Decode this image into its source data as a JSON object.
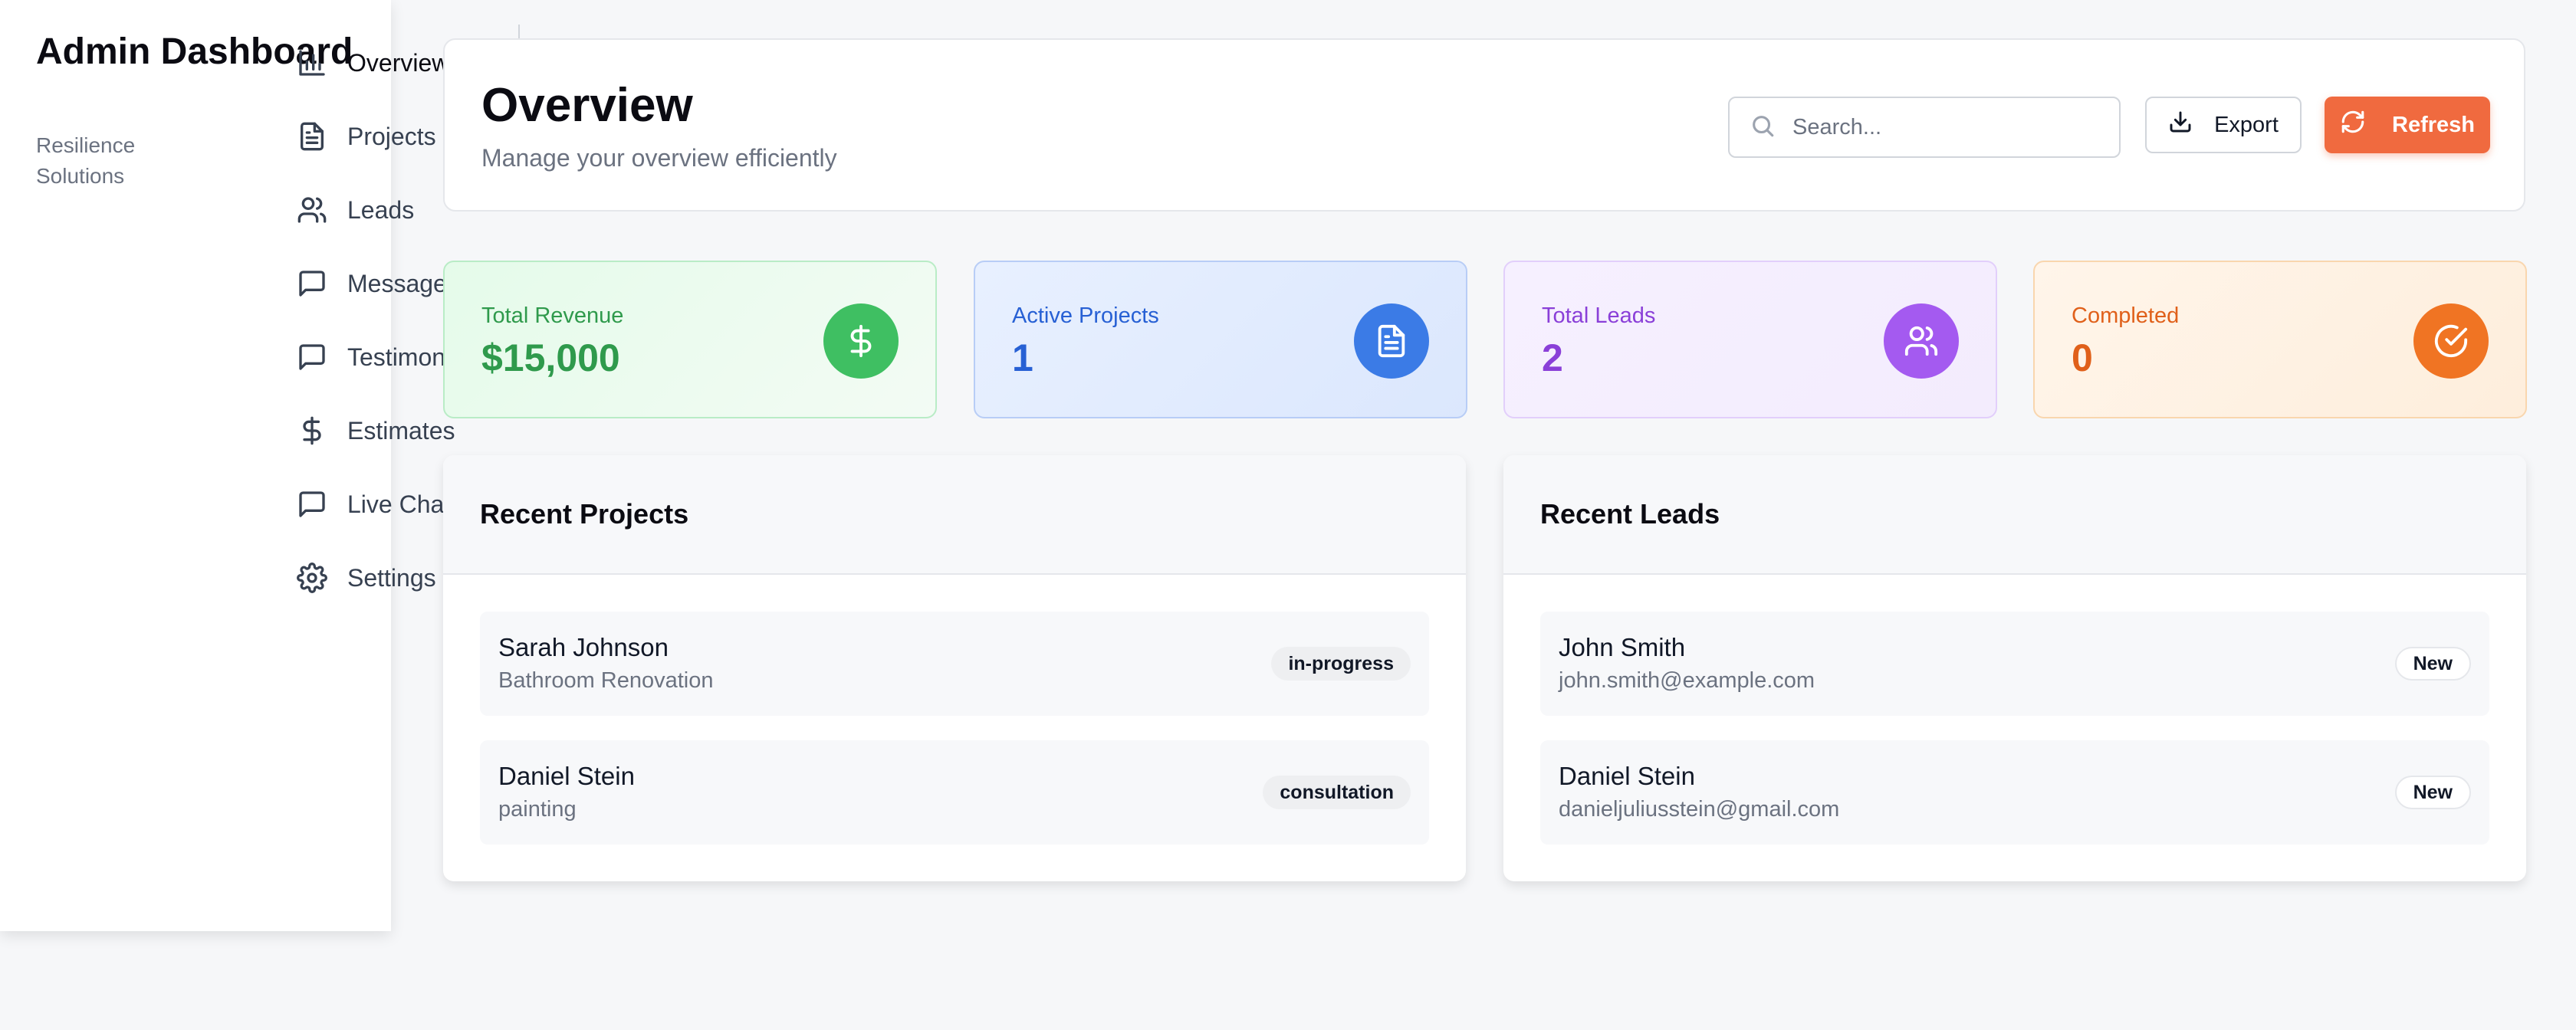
{
  "sidebar": {
    "brand_title": "Admin Dashboard",
    "brand_subtitle": "Resilience Solutions",
    "items": [
      {
        "label": "Overview",
        "icon": "bar-chart-icon"
      },
      {
        "label": "Projects",
        "icon": "file-text-icon"
      },
      {
        "label": "Leads",
        "icon": "users-icon"
      },
      {
        "label": "Messages",
        "icon": "message-icon"
      },
      {
        "label": "Testimonials",
        "icon": "message-icon"
      },
      {
        "label": "Estimates",
        "icon": "dollar-icon"
      },
      {
        "label": "Live Chat",
        "icon": "message-icon"
      },
      {
        "label": "Settings",
        "icon": "gear-icon"
      }
    ],
    "active": "Overview"
  },
  "header": {
    "title": "Overview",
    "subtitle": "Manage your overview efficiently",
    "search_placeholder": "Search...",
    "export_label": "Export",
    "refresh_label": "Refresh"
  },
  "stats": [
    {
      "label": "Total Revenue",
      "value": "$15,000",
      "icon": "dollar-icon",
      "color": "#3fbf62"
    },
    {
      "label": "Active Projects",
      "value": "1",
      "icon": "file-text-icon",
      "color": "#3b7be6"
    },
    {
      "label": "Total Leads",
      "value": "2",
      "icon": "users-icon",
      "color": "#a45af0"
    },
    {
      "label": "Completed",
      "value": "0",
      "icon": "check-circle-icon",
      "color": "#f07423"
    }
  ],
  "recent_projects": {
    "title": "Recent Projects",
    "rows": [
      {
        "name": "Sarah Johnson",
        "detail": "Bathroom Renovation",
        "status": "in-progress"
      },
      {
        "name": "Daniel Stein",
        "detail": "painting",
        "status": "consultation"
      }
    ]
  },
  "recent_leads": {
    "title": "Recent Leads",
    "rows": [
      {
        "name": "John Smith",
        "detail": "john.smith@example.com",
        "status": "New"
      },
      {
        "name": "Daniel Stein",
        "detail": "danieljuliusstein@gmail.com",
        "status": "New"
      }
    ]
  },
  "colors": {
    "accent": "#f06a3f",
    "background": "#f6f7f9"
  }
}
